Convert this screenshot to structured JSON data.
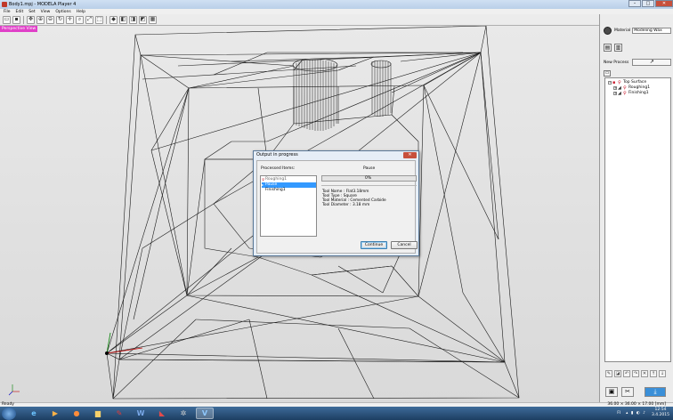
{
  "window": {
    "title": "Body1.mpj - MODELA Player 4",
    "min": "–",
    "max": "□",
    "close": "✕"
  },
  "menu": [
    "File",
    "Edit",
    "Set",
    "View",
    "Options",
    "Help"
  ],
  "viewport": {
    "label": "Perspective View"
  },
  "right_panel": {
    "material_label": "Material",
    "material_value": "Modeling Wax",
    "new_process_label": "New Process",
    "tree": {
      "root": "Top Surface",
      "children": [
        "Roughing1",
        "Finishing1"
      ]
    }
  },
  "dialog": {
    "title": "Output in progress",
    "close": "✕",
    "processed_label": "Processed Items:",
    "items": [
      "Roughing1",
      "Pause",
      "Finishing1"
    ],
    "pause_label": "Pause",
    "progress_text": "0%",
    "progress": 0,
    "tool_name": "Tool Name : Flat3.18mm",
    "tool_type": "Tool Type : Square",
    "tool_material": "Tool Material : Cemented Carbide",
    "tool_diameter": "Tool Diameter : 3.18 mm",
    "continue_label": "Continue",
    "cancel_label": "Cancel"
  },
  "status": {
    "ready": "Ready",
    "dimensions": "36.00 × 36.00 × 17.00 [mm]"
  },
  "taskbar": {
    "lang": "FI",
    "time": "12:54",
    "date": "3.4.2015"
  },
  "colors": {
    "view_label_bg": "#e040c8",
    "selection": "#3399ff",
    "taskbar": "#1d3e62"
  }
}
